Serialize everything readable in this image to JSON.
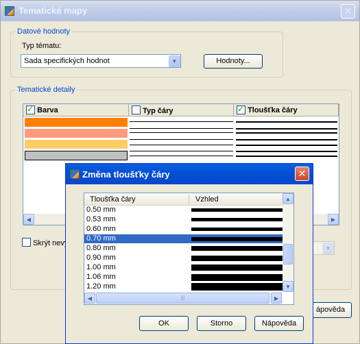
{
  "main": {
    "title": "Tematické mapy",
    "close_glyph": "✕",
    "data_group": {
      "label": "Datové hodnoty",
      "type_label": "Typ tématu:",
      "type_value": "Sada specifických hodnot",
      "values_button": "Hodnoty..."
    },
    "details_group": {
      "label": "Tematické detaily",
      "columns": [
        "Barva",
        "Typ čáry",
        "Tloušťka čáry"
      ],
      "rows": [
        {
          "color": "#ff8000"
        },
        {
          "color": "#ff9980"
        },
        {
          "color": "#ffcc66"
        },
        {
          "color": "#c0c0c0"
        }
      ]
    },
    "hide_label": "Skrýt nevy",
    "help_button": "ápověda"
  },
  "dialog": {
    "title": "Změna tloušťky čáry",
    "close_glyph": "✕",
    "columns": [
      "Tloušťka čáry",
      "Vzhled"
    ],
    "rows": [
      {
        "label": "0.50 mm",
        "thickness": 0.5
      },
      {
        "label": "0.53 mm",
        "thickness": 0.53
      },
      {
        "label": "0.60 mm",
        "thickness": 0.6
      },
      {
        "label": "0.70 mm",
        "thickness": 0.7,
        "selected": true
      },
      {
        "label": "0.80 mm",
        "thickness": 0.8
      },
      {
        "label": "0.90 mm",
        "thickness": 0.9
      },
      {
        "label": "1.00 mm",
        "thickness": 1.0
      },
      {
        "label": "1.06 mm",
        "thickness": 1.06
      },
      {
        "label": "1.20 mm",
        "thickness": 1.2
      }
    ],
    "buttons": {
      "ok": "OK",
      "cancel": "Storno",
      "help": "Nápověda"
    }
  }
}
